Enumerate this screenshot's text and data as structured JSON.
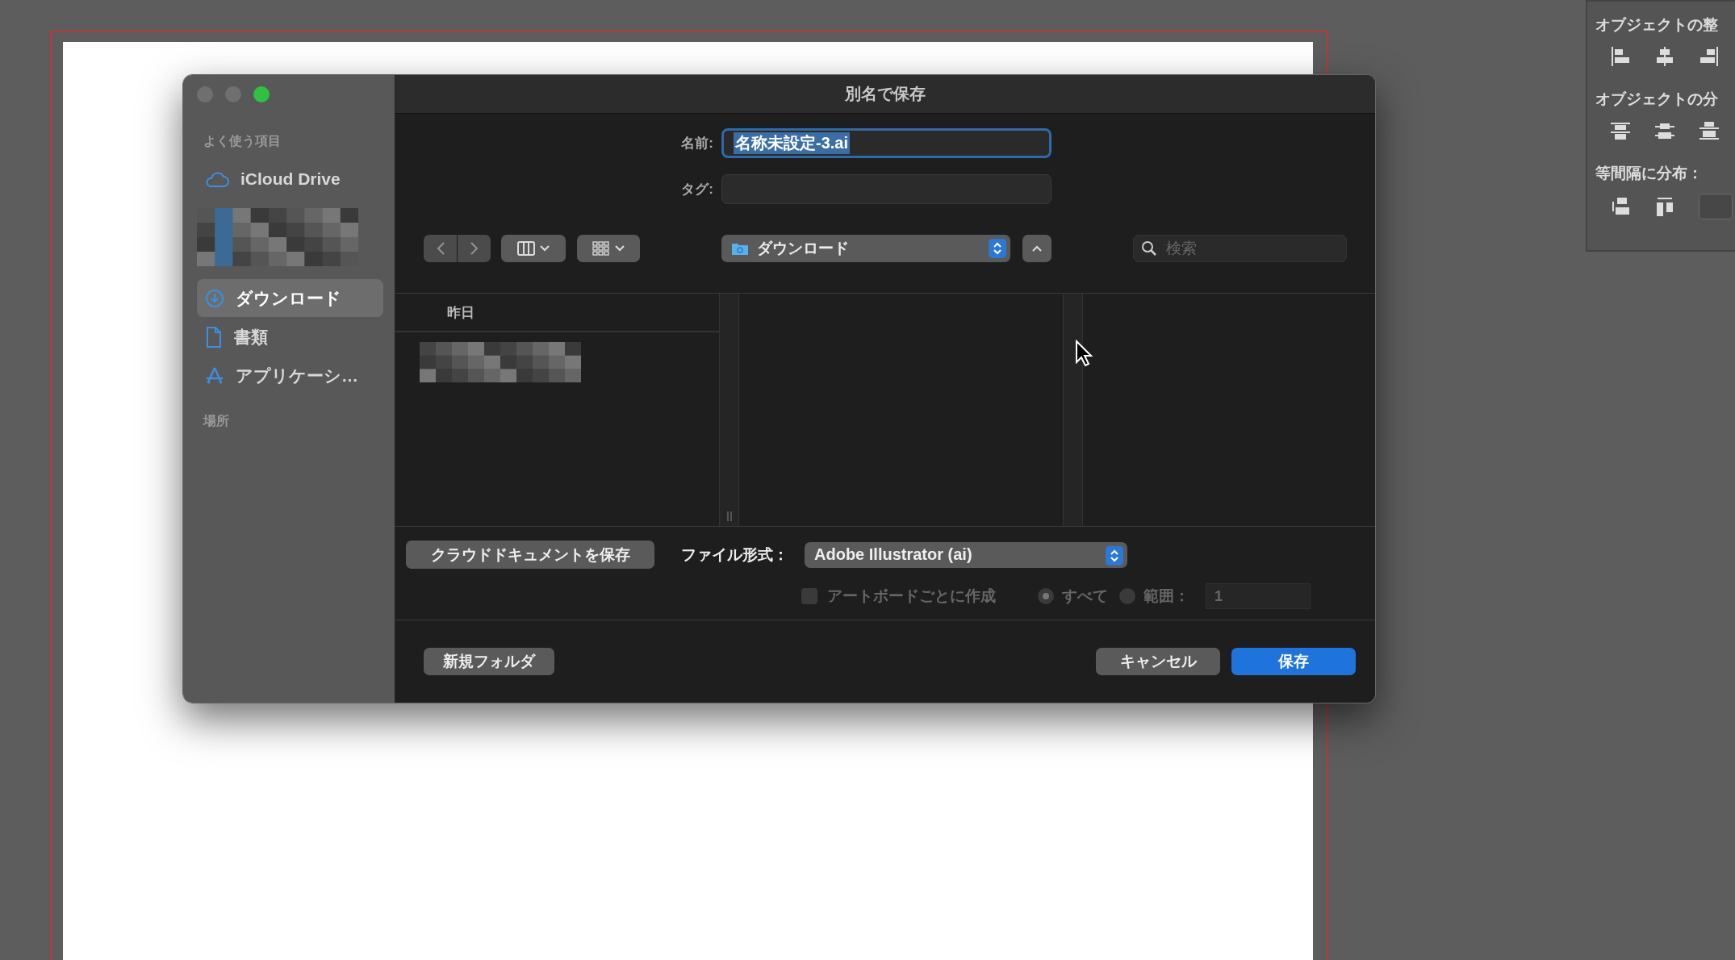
{
  "window": {
    "title": "別名で保存"
  },
  "sidebar": {
    "favorites_heading": "よく使う項目",
    "items": [
      {
        "kind": "cloud",
        "label": "iCloud Drive",
        "selected": false
      },
      {
        "kind": "redacted",
        "selected": false
      },
      {
        "kind": "download",
        "label": "ダウンロード",
        "selected": true
      },
      {
        "kind": "document",
        "label": "書類",
        "selected": false
      },
      {
        "kind": "apps",
        "label": "アプリケーシ…",
        "selected": false
      }
    ],
    "places_heading": "場所"
  },
  "name_field": {
    "label": "名前:",
    "value": "名称未設定-3.ai",
    "focused": true
  },
  "tag_field": {
    "label": "タグ:"
  },
  "toolbar": {
    "location": "ダウンロード",
    "search": {
      "placeholder": "検索"
    }
  },
  "browser": {
    "columns": [
      {
        "header": "昨日",
        "kind": "list"
      },
      {
        "kind": "empty"
      },
      {
        "kind": "empty"
      }
    ]
  },
  "options": {
    "cloud_button": "クラウドドキュメントを保存",
    "format": {
      "label": "ファイル形式：",
      "value": "Adobe Illustrator (ai)"
    },
    "artboard_checkbox": {
      "label": "アートボードごとに作成",
      "checked": false,
      "disabled": true
    },
    "range_options": [
      {
        "label": "すべて",
        "selected": true
      },
      {
        "label": "範囲：",
        "selected": false
      }
    ],
    "range_field": {
      "value": "1",
      "disabled": true
    }
  },
  "buttons": [
    {
      "kind": "secondary",
      "label": "新規フォルダ"
    },
    {
      "kind": "spacer"
    },
    {
      "kind": "secondary",
      "label": "キャンセル"
    },
    {
      "kind": "default",
      "label": "保存"
    }
  ],
  "right_panel": {
    "sections": [
      {
        "title": "オブジェクトの整",
        "kind": "align"
      },
      {
        "title": "オブジェクトの分",
        "kind": "distribute"
      },
      {
        "title": "等間隔に分布：",
        "kind": "spacing"
      }
    ]
  }
}
